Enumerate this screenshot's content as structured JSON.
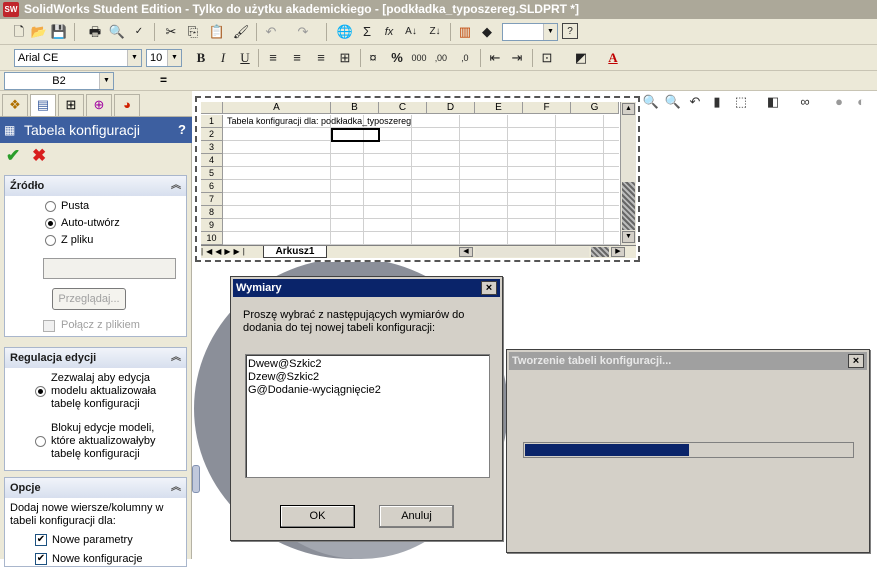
{
  "title": "SolidWorks Student Edition - Tylko do użytku akademickiego - [podkładka_typoszereg.SLDPRT *]",
  "toolbar": {
    "font_name": "Arial CE",
    "font_size": "10",
    "bold": "B",
    "italic": "I",
    "underline": "U",
    "percent": "%",
    "thousands": "000",
    "dec_inc": "‚00",
    "dec_dec": "‚0",
    "formula_sigma": "Σ",
    "fx": "fx"
  },
  "name_box": "B2",
  "formula_eq": "=",
  "panel": {
    "title": "Tabela konfiguracji",
    "help": "?",
    "source": {
      "heading": "Źródło",
      "options": [
        "Pusta",
        "Auto-utwórz",
        "Z pliku"
      ],
      "selected": 1,
      "file_value": "",
      "browse": "Przeglądaj...",
      "link_label": "Połącz z plikiem"
    },
    "edit": {
      "heading": "Regulacja edycji",
      "option1": [
        "Zezwalaj aby edycja",
        "modelu aktualizowała",
        "tabelę konfiguracji"
      ],
      "option2": [
        "Blokuj edycje modeli,",
        "które aktualizowałyby",
        "tabelę konfiguracji"
      ]
    },
    "options": {
      "heading": "Opcje",
      "text": [
        "Dodaj nowe wiersze/kolumny w",
        "tabeli konfiguracji dla:"
      ],
      "chk1": "Nowe parametry",
      "chk2": "Nowe konfiguracje"
    }
  },
  "sheet": {
    "columns": [
      "A",
      "B",
      "C",
      "D",
      "E",
      "F",
      "G"
    ],
    "rows": [
      "1",
      "2",
      "3",
      "4",
      "5",
      "6",
      "7",
      "8",
      "9",
      "10"
    ],
    "a1": "Tabela konfiguracji dla: podkładka_typoszereg",
    "tab": "Arkusz1"
  },
  "dialog_dims": {
    "title": "Wymiary",
    "prompt": [
      "Proszę wybrać z następujących wymiarów do",
      "dodania do tej nowej tabeli konfiguracji:"
    ],
    "items": [
      "Dwew@Szkic2",
      "Dzew@Szkic2",
      "G@Dodanie-wyciągnięcie2"
    ],
    "ok": "OK",
    "cancel": "Anuluj",
    "close": "×"
  },
  "dialog_progress": {
    "title": "Tworzenie tabeli konfiguracji...",
    "close": "×",
    "progress": 0.5
  },
  "colors": {
    "accent": "#3d5fa0",
    "progress_fill": "#0a246a",
    "dialog_title_active": "#0a246a",
    "dialog_title_inactive": "#808080"
  }
}
